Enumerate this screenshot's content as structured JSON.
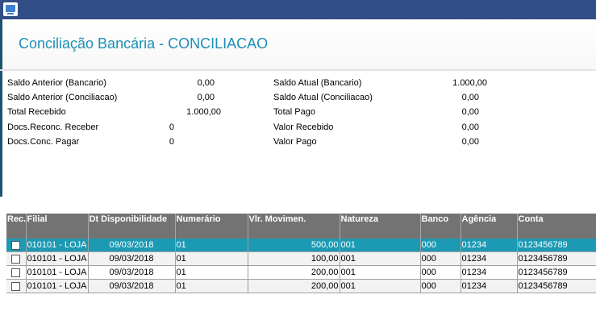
{
  "window": {
    "icon": "app-window-icon"
  },
  "title": "Conciliação Bancária - CONCILIACAO",
  "summary": {
    "left": [
      {
        "label": "Saldo Anterior (Bancario)",
        "value": "0,00"
      },
      {
        "label": "Saldo Anterior (Conciliacao)",
        "value": "0,00"
      },
      {
        "label": "Total Recebido",
        "value": "1.000,00"
      },
      {
        "label": "Docs.Reconc. Receber",
        "value": "0"
      },
      {
        "label": "Docs.Conc. Pagar",
        "value": "0"
      }
    ],
    "right": [
      {
        "label": "Saldo Atual (Bancario)",
        "value": "1.000,00"
      },
      {
        "label": "Saldo Atual (Conciliacao)",
        "value": "0,00"
      },
      {
        "label": "Total Pago",
        "value": "0,00"
      },
      {
        "label": "Valor Recebido",
        "value": "0,00"
      },
      {
        "label": "Valor Pago",
        "value": "0,00"
      }
    ]
  },
  "grid": {
    "columns": [
      "Rec.",
      "Filial",
      "Dt Disponibilidade",
      "Numerário",
      "Vlr. Movimen.",
      "Natureza",
      "Banco",
      "Agência",
      "Conta"
    ],
    "rows": [
      {
        "filial": "010101 - LOJA",
        "data": "09/03/2018",
        "numerario": "01",
        "valor": "500,00",
        "natureza": "001",
        "banco": "000",
        "agencia": "01234",
        "conta": "0123456789",
        "selected": true
      },
      {
        "filial": "010101 - LOJA",
        "data": "09/03/2018",
        "numerario": "01",
        "valor": "100,00",
        "natureza": "001",
        "banco": "000",
        "agencia": "01234",
        "conta": "0123456789",
        "selected": false
      },
      {
        "filial": "010101 - LOJA",
        "data": "09/03/2018",
        "numerario": "01",
        "valor": "200,00",
        "natureza": "001",
        "banco": "000",
        "agencia": "01234",
        "conta": "0123456789",
        "selected": false
      },
      {
        "filial": "010101 - LOJA",
        "data": "09/03/2018",
        "numerario": "01",
        "valor": "200,00",
        "natureza": "001",
        "banco": "000",
        "agencia": "01234",
        "conta": "0123456789",
        "selected": false
      }
    ]
  },
  "colors": {
    "topbar": "#314f86",
    "title": "#1e8fb5",
    "selected_row": "#1c9ab4",
    "header": "#737373"
  }
}
